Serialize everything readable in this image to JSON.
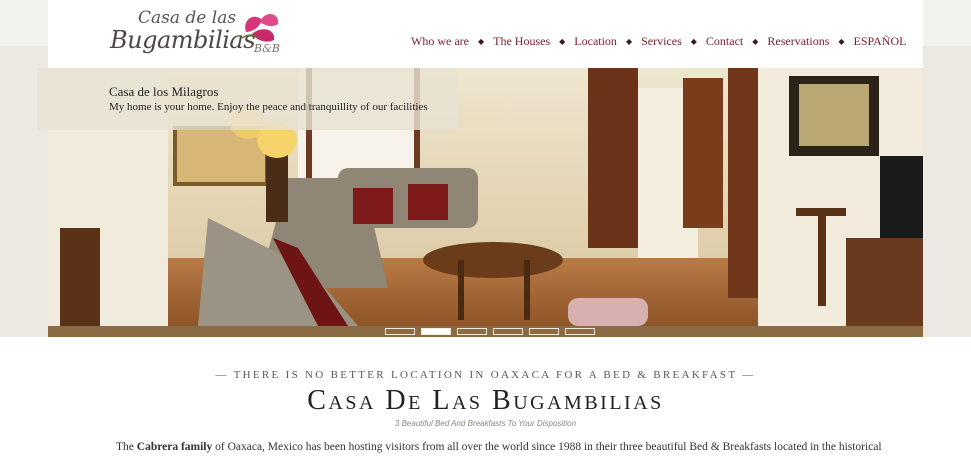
{
  "logo": {
    "line1": "Casa de las",
    "line2": "Bugambilias",
    "suffix": "B&B"
  },
  "nav": {
    "items": [
      {
        "label": "Who we are"
      },
      {
        "label": "The Houses"
      },
      {
        "label": "Location"
      },
      {
        "label": "Services"
      },
      {
        "label": "Contact"
      },
      {
        "label": "Reservations"
      },
      {
        "label": "ESPAÑOL"
      }
    ],
    "separator": "◆"
  },
  "slider": {
    "caption_title": "Casa de los Milagros",
    "caption_text": "My home is your home. Enjoy the peace and tranquillity of our facilities",
    "slide_count": 6,
    "active_index": 1
  },
  "intro": {
    "tagline": "— There is no better location in Oaxaca for a Bed & Breakfast —",
    "title": "Casa De Las Bugambilias",
    "subtitle": "3 Beautiful Bed And Breakfasts To Your Disposition",
    "text_before": "The ",
    "text_bold": "Cabrera family",
    "text_after": " of Oaxaca, Mexico has been hosting visitors from all over the world since 1988 in their three beautiful Bed & Breakfasts located in the historical"
  },
  "colors": {
    "nav_text": "#7b2033",
    "slider_bar": "#8a6b43",
    "page_background_side": "#ece9e3"
  }
}
